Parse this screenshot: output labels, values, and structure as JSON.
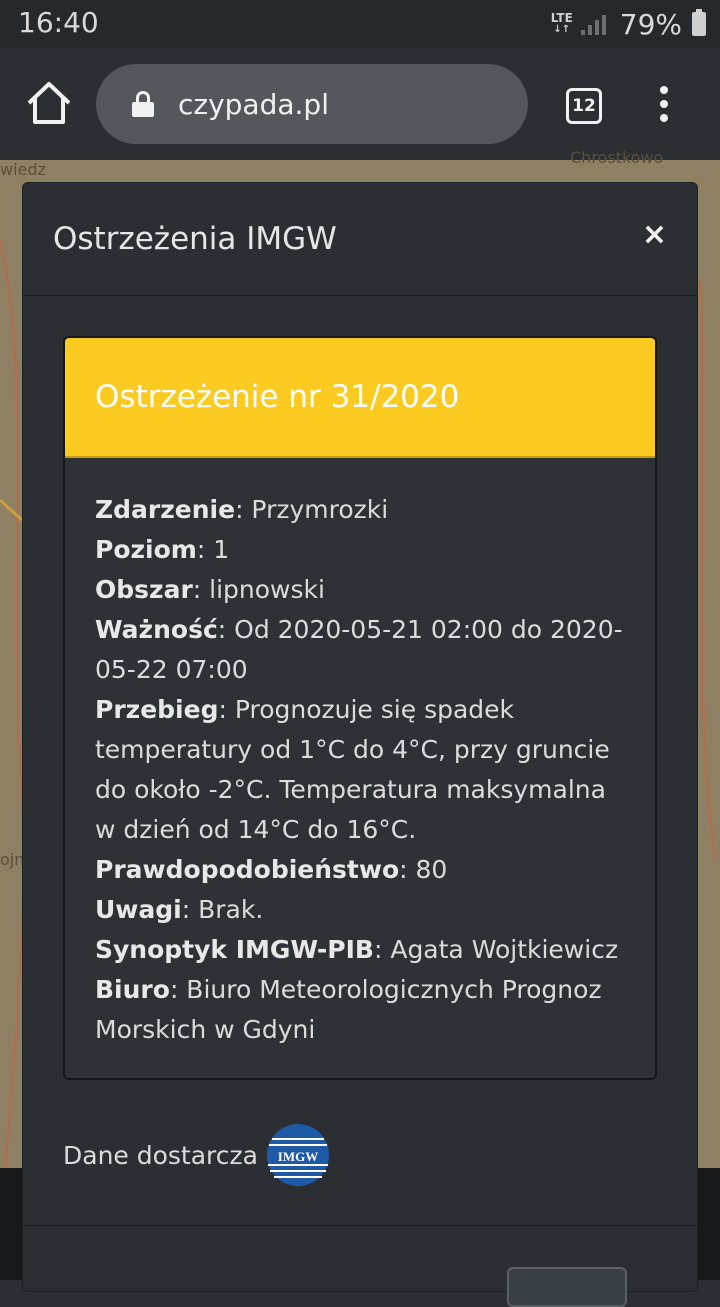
{
  "status_bar": {
    "time": "16:40",
    "network": "LTE",
    "battery": "79%"
  },
  "browser": {
    "url": "czypada.pl",
    "tab_count": "12"
  },
  "map_labels": [
    "wiedz",
    "Chrostkowo",
    "ojn"
  ],
  "modal": {
    "title": "Ostrzeżenia IMGW",
    "close_label": "×",
    "warning": {
      "title": "Ostrzeżenie nr 31/2020",
      "header_color": "#fbcb22",
      "fields": [
        {
          "label": "Zdarzenie",
          "value": ": Przymrozki"
        },
        {
          "label": "Poziom",
          "value": ": 1"
        },
        {
          "label": "Obszar",
          "value": ": lipnowski"
        },
        {
          "label": "Ważność",
          "value": ": Od 2020-05-21 02:00 do 2020-05-22 07:00"
        },
        {
          "label": "Przebieg",
          "value": ": Prognozuje się spadek temperatury od 1°C do 4°C, przy gruncie do około -2°C. Temperatura maksymalna w dzień od 14°C do 16°C."
        },
        {
          "label": "Prawdopodobieństwo",
          "value": ": 80"
        },
        {
          "label": "Uwagi",
          "value": ": Brak."
        },
        {
          "label": "Synoptyk IMGW-PIB",
          "value": ": Agata Wojtkiewicz"
        },
        {
          "label": "Biuro",
          "value": ": Biuro Meteorologicznych Prognoz Morskich w Gdyni"
        }
      ]
    },
    "source_text": "Dane dostarcza",
    "logo_text": "IMGW"
  }
}
